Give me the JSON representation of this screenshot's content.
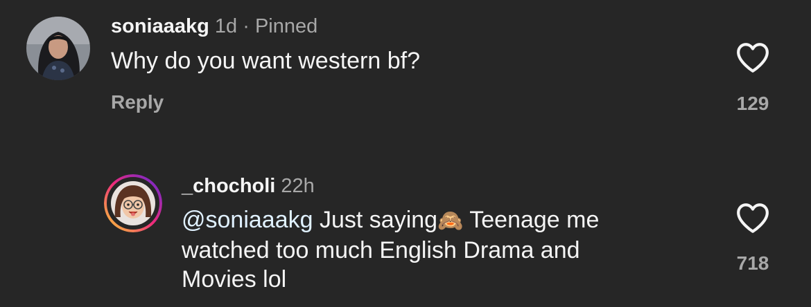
{
  "comments": [
    {
      "username": "soniaaakg",
      "time": "1d",
      "separator": "·",
      "pinned": "Pinned",
      "text": "Why do you want western bf?",
      "reply_label": "Reply",
      "likes": "129"
    },
    {
      "username": "_chocholi",
      "time": "22h",
      "mention": "@soniaaakg",
      "text_line1": " Just saying",
      "emoji": "🙈",
      "text_line1_b": " Teenage me",
      "text_line2": "watched too much English Drama and",
      "text_line3": "Movies lol",
      "likes": "718"
    }
  ],
  "icons": {
    "like": "heart-outline-icon"
  },
  "colors": {
    "background": "#262626",
    "primary_text": "#f5f5f5",
    "secondary_text": "#a8a8a8",
    "story_ring_start": "#f9ce34",
    "story_ring_mid": "#ee2a7b",
    "story_ring_end": "#6228d7"
  }
}
